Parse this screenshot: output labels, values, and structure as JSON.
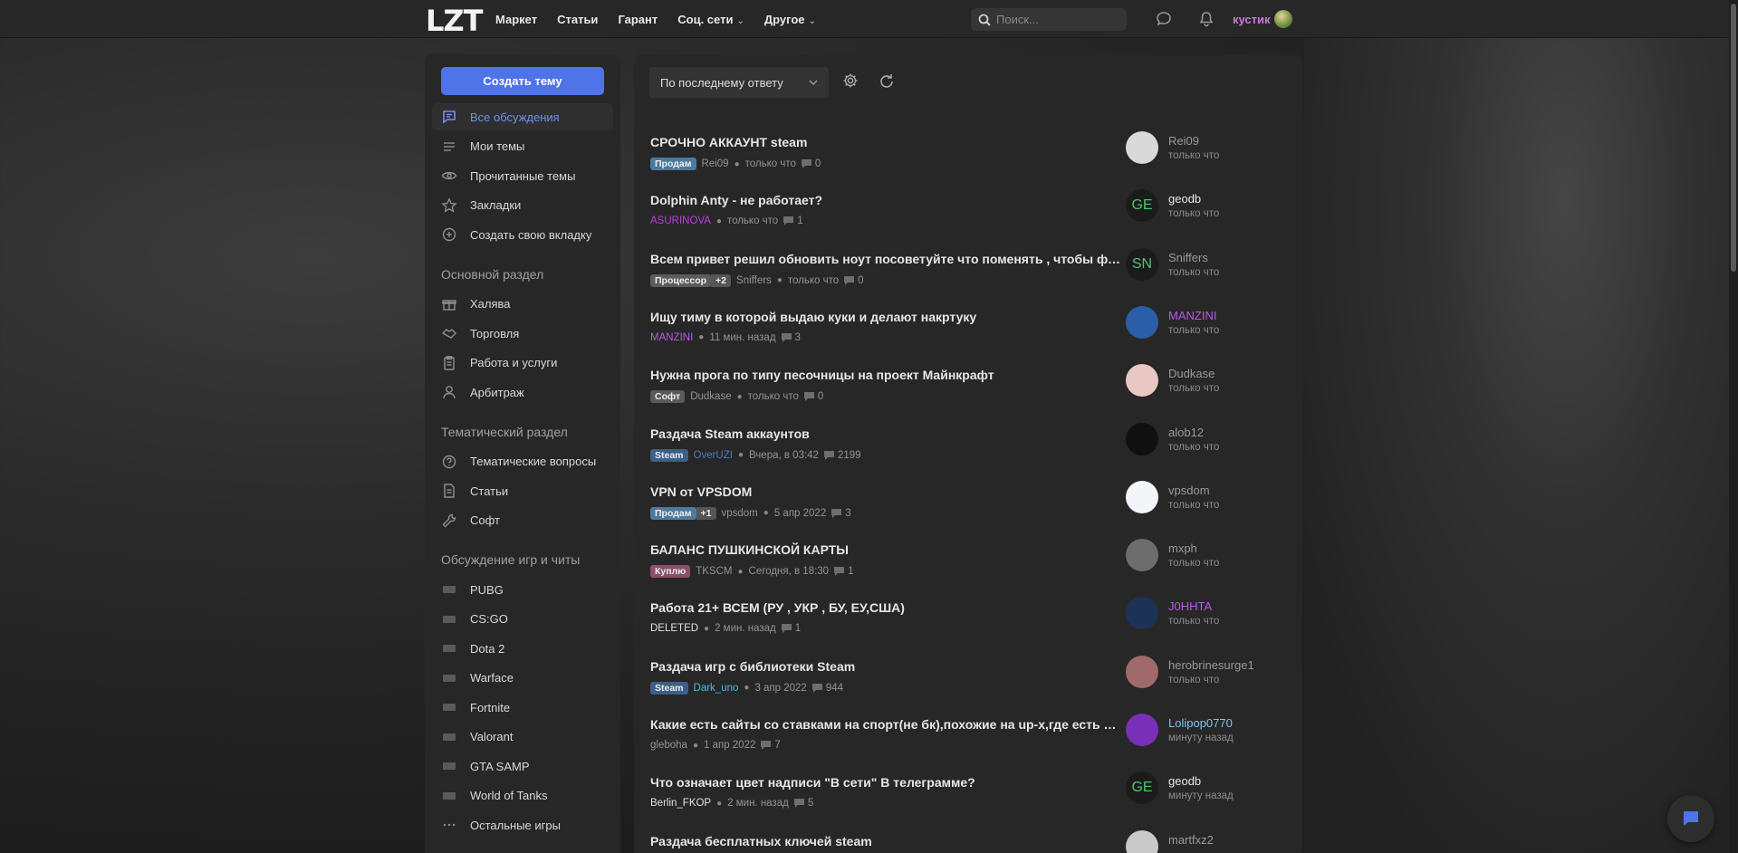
{
  "header": {
    "logo": "LZT",
    "nav": [
      {
        "label": "Маркет",
        "dropdown": false
      },
      {
        "label": "Статьи",
        "dropdown": false
      },
      {
        "label": "Гарант",
        "dropdown": false
      },
      {
        "label": "Соц. сети",
        "dropdown": true
      },
      {
        "label": "Другое",
        "dropdown": true
      }
    ],
    "search_placeholder": "Поиск...",
    "username": "кустик"
  },
  "sidebar": {
    "create_button": "Создать тему",
    "items": [
      {
        "label": "Все обсуждения",
        "icon": "chat-icon",
        "active": true
      },
      {
        "label": "Мои темы",
        "icon": "list-icon"
      },
      {
        "label": "Прочитанные темы",
        "icon": "eye-icon"
      },
      {
        "label": "Закладки",
        "icon": "star-icon"
      },
      {
        "label": "Создать свою вкладку",
        "icon": "plus-circle-icon"
      }
    ],
    "sections": [
      {
        "title": "Основной раздел",
        "items": [
          {
            "label": "Халява",
            "icon": "gift-icon"
          },
          {
            "label": "Торговля",
            "icon": "handshake-icon"
          },
          {
            "label": "Работа и услуги",
            "icon": "clipboard-icon"
          },
          {
            "label": "Арбитраж",
            "icon": "user-icon"
          }
        ]
      },
      {
        "title": "Тематический раздел",
        "items": [
          {
            "label": "Тематические вопросы",
            "icon": "question-icon"
          },
          {
            "label": "Статьи",
            "icon": "document-icon"
          },
          {
            "label": "Софт",
            "icon": "wrench-icon"
          }
        ]
      },
      {
        "title": "Обсуждение игр и читы",
        "items": [
          {
            "label": "PUBG",
            "icon": "pubg-icon"
          },
          {
            "label": "CS:GO",
            "icon": "csgo-icon"
          },
          {
            "label": "Dota 2",
            "icon": "dota-icon"
          },
          {
            "label": "Warface",
            "icon": "warface-icon"
          },
          {
            "label": "Fortnite",
            "icon": "fortnite-icon"
          },
          {
            "label": "Valorant",
            "icon": "valorant-icon"
          },
          {
            "label": "GTA SAMP",
            "icon": "gta-icon"
          },
          {
            "label": "World of Tanks",
            "icon": "tank-icon"
          },
          {
            "label": "Остальные игры",
            "icon": "more-icon"
          }
        ]
      }
    ]
  },
  "main": {
    "sort_label": "По последнему ответу",
    "threads": [
      {
        "title": "СРОЧНО АККАУНТ steam",
        "tag": "Продам",
        "tag_color": "#4d7a9c",
        "tag_plus": "",
        "author": "Rei09",
        "author_color": "#949494",
        "time": "только что",
        "comments": "0",
        "last_user": "Rei09",
        "last_user_color": "#9a9a9a",
        "last_time": "только что",
        "avatar": "",
        "avatar_bg": "#d9d9d9"
      },
      {
        "title": "Dolphin Anty - не работает?",
        "tag": "",
        "tag_color": "",
        "tag_plus": "",
        "author": "ASURINOVA",
        "author_color": "#c43de6",
        "time": "только что",
        "comments": "1",
        "last_user": "geodb",
        "last_user_color": "#e6e6e6",
        "last_time": "только что",
        "avatar": "GE",
        "avatar_bg": "#1b1b1b"
      },
      {
        "title": "Всем привет решил обновить ноут посоветуйте что поменять , чтобы форт пашел",
        "tag": "Процессор",
        "tag_color": "#5c5c5c",
        "tag_plus": "+2",
        "author": "Sniffers",
        "author_color": "#949494",
        "time": "только что",
        "comments": "0",
        "last_user": "Sniffers",
        "last_user_color": "#9a9a9a",
        "last_time": "только что",
        "avatar": "SN",
        "avatar_bg": "#1b1b1b"
      },
      {
        "title": "Ищу тиму в которой выдаю куки и делают накртуку",
        "tag": "",
        "tag_color": "",
        "tag_plus": "",
        "author": "MANZINI",
        "author_color": "#b45ddb",
        "time": "11 мин. назад",
        "comments": "3",
        "last_user": "MANZINI",
        "last_user_color": "#b45ddb",
        "last_time": "только что",
        "avatar": "",
        "avatar_bg": "#2a5ea8"
      },
      {
        "title": "Нужна прога по типу песочницы на проект Майнкрафт",
        "tag": "Софт",
        "tag_color": "#5a5a5a",
        "tag_plus": "",
        "author": "Dudkase",
        "author_color": "#949494",
        "time": "только что",
        "comments": "0",
        "last_user": "Dudkase",
        "last_user_color": "#9a9a9a",
        "last_time": "только что",
        "avatar": "",
        "avatar_bg": "#e9c7c4"
      },
      {
        "title": "Раздача Steam аккаунтов",
        "tag": "Steam",
        "tag_color": "#3d5f86",
        "tag_plus": "",
        "author": "OverUZI",
        "author_color": "#4b78c9",
        "time": "Вчера, в 03:42",
        "comments": "2199",
        "last_user": "alob12",
        "last_user_color": "#9a9a9a",
        "last_time": "только что",
        "avatar": "",
        "avatar_bg": "#101010"
      },
      {
        "title": "VPN от VPSDOM",
        "tag": "Продам",
        "tag_color": "#4d7a9c",
        "tag_plus": "+1",
        "author": "vpsdom",
        "author_color": "#949494",
        "time": "5 апр 2022",
        "comments": "3",
        "last_user": "vpsdom",
        "last_user_color": "#9a9a9a",
        "last_time": "только что",
        "avatar": "",
        "avatar_bg": "#f2f6fa"
      },
      {
        "title": "БАЛАНС ПУШКИНСКОЙ КАРТЫ",
        "tag": "Куплю",
        "tag_color": "#8a4f6b",
        "tag_plus": "",
        "author": "TKSCM",
        "author_color": "#949494",
        "time": "Сегодня, в 18:30",
        "comments": "1",
        "last_user": "mxph",
        "last_user_color": "#9a9a9a",
        "last_time": "только что",
        "avatar": "",
        "avatar_bg": "#6d6d6d"
      },
      {
        "title": "Работа 21+ ВСЕМ (РУ , УКР , БУ, ЕУ,США)",
        "tag": "",
        "tag_color": "",
        "tag_plus": "",
        "author": "DELETED",
        "author_color": "#e0e0e0",
        "time": "2 мин. назад",
        "comments": "1",
        "last_user": "J0HHTA",
        "last_user_color": "#b45ddb",
        "last_time": "только что",
        "avatar": "",
        "avatar_bg": "#1c3357"
      },
      {
        "title": "Раздача игр с библиотеки Steam",
        "tag": "Steam",
        "tag_color": "#3d5f86",
        "tag_plus": "",
        "author": "Dark_uno",
        "author_color": "#4fb6e8",
        "time": "3 апр 2022",
        "comments": "944",
        "last_user": "herobrinesurge1",
        "last_user_color": "#9a9a9a",
        "last_time": "только что",
        "avatar": "",
        "avatar_bg": "#a06a6a"
      },
      {
        "title": "Какие есть сайты со ставками на спорт(не бк),похожие на up-x,где есть раздел мины?",
        "tag": "",
        "tag_color": "",
        "tag_plus": "",
        "author": "gleboha",
        "author_color": "#949494",
        "time": "1 апр 2022",
        "comments": "7",
        "last_user": "Lolipop0770",
        "last_user_color": "#7fc4f0",
        "last_time": "минуту назад",
        "avatar": "",
        "avatar_bg": "#7a2fb8"
      },
      {
        "title": "Что означает цвет надписи \"В сети\" В телеграмме?",
        "tag": "",
        "tag_color": "",
        "tag_plus": "",
        "author": "Berlin_FKOP",
        "author_color": "#e0e0e0",
        "time": "2 мин. назад",
        "comments": "5",
        "last_user": "geodb",
        "last_user_color": "#e6e6e6",
        "last_time": "минуту назад",
        "avatar": "GE",
        "avatar_bg": "#1b1b1b"
      },
      {
        "title": "Раздача бесплатных ключей steam",
        "tag": "",
        "tag_color": "",
        "tag_plus": "",
        "author": "",
        "author_color": "#949494",
        "time": "",
        "comments": "",
        "last_user": "martfxz2",
        "last_user_color": "#9a9a9a",
        "last_time": "",
        "avatar": "",
        "avatar_bg": "#c9c9c9"
      }
    ]
  }
}
